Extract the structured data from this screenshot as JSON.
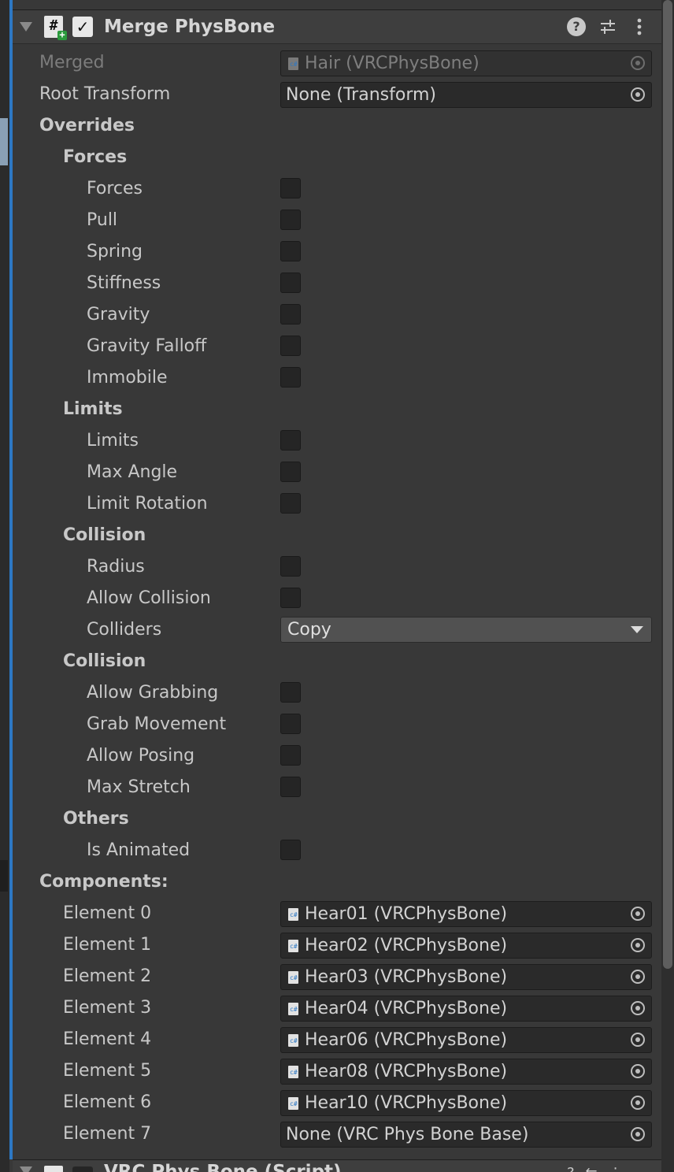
{
  "header": {
    "title": "Merge PhysBone",
    "enabled": true,
    "icons": [
      "foldout-arrow-icon",
      "script-icon",
      "help-icon",
      "presets-icon",
      "context-menu-icon"
    ]
  },
  "fields": {
    "merged": {
      "label": "Merged",
      "value": "Hair (VRCPhysBone)",
      "disabled": true
    },
    "root_transform": {
      "label": "Root Transform",
      "value": "None (Transform)"
    }
  },
  "overrides": {
    "label": "Overrides",
    "forces": {
      "label": "Forces",
      "items": [
        {
          "label": "Forces",
          "checked": false
        },
        {
          "label": "Pull",
          "checked": false
        },
        {
          "label": "Spring",
          "checked": false
        },
        {
          "label": "Stiffness",
          "checked": false
        },
        {
          "label": "Gravity",
          "checked": false
        },
        {
          "label": "Gravity Falloff",
          "checked": false
        },
        {
          "label": "Immobile",
          "checked": false
        }
      ]
    },
    "limits": {
      "label": "Limits",
      "items": [
        {
          "label": "Limits",
          "checked": false
        },
        {
          "label": "Max Angle",
          "checked": false
        },
        {
          "label": "Limit Rotation",
          "checked": false
        }
      ]
    },
    "collision": {
      "label": "Collision",
      "items": [
        {
          "label": "Radius",
          "checked": false
        },
        {
          "label": "Allow Collision",
          "checked": false
        }
      ],
      "colliders": {
        "label": "Colliders",
        "value": "Copy"
      }
    },
    "collision2": {
      "label": "Collision",
      "items": [
        {
          "label": "Allow Grabbing",
          "checked": false
        },
        {
          "label": "Grab Movement",
          "checked": false
        },
        {
          "label": "Allow Posing",
          "checked": false
        },
        {
          "label": "Max Stretch",
          "checked": false
        }
      ]
    },
    "others": {
      "label": "Others",
      "items": [
        {
          "label": "Is Animated",
          "checked": false
        }
      ]
    }
  },
  "components": {
    "label": "Components:",
    "elements": [
      {
        "label": "Element 0",
        "value": "Hear01 (VRCPhysBone)"
      },
      {
        "label": "Element 1",
        "value": "Hear02 (VRCPhysBone)"
      },
      {
        "label": "Element 2",
        "value": "Hear03 (VRCPhysBone)"
      },
      {
        "label": "Element 3",
        "value": "Hear04 (VRCPhysBone)"
      },
      {
        "label": "Element 4",
        "value": "Hear06 (VRCPhysBone)"
      },
      {
        "label": "Element 5",
        "value": "Hear08 (VRCPhysBone)"
      },
      {
        "label": "Element 6",
        "value": "Hear10 (VRCPhysBone)"
      },
      {
        "label": "Element 7",
        "value": "None (VRC Phys Bone Base)"
      }
    ]
  },
  "next_component": {
    "title": "VRC Phys Bone (Script)"
  },
  "colors": {
    "background": "#383838",
    "accent_bar": "#2d78c4",
    "field_bg": "#2a2a2a",
    "dropdown_bg": "#515151",
    "text": "#c8c8c8"
  }
}
